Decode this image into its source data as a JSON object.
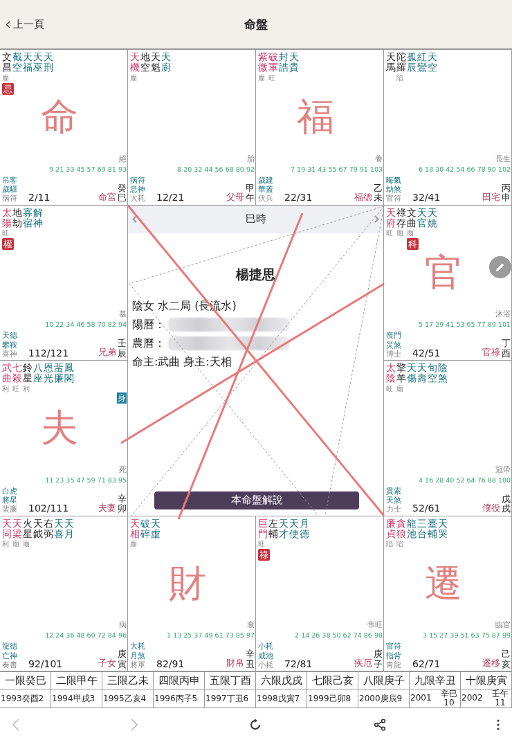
{
  "header": {
    "back": "上一頁",
    "title": "命盤"
  },
  "palaces": [
    {
      "stars": [
        {
          "name": "文昌",
          "kind": "minor",
          "brightness": "廟",
          "transform": "忌"
        },
        {
          "name": "截空",
          "kind": "aux"
        },
        {
          "name": "天福",
          "kind": "aux"
        },
        {
          "name": "天巫",
          "kind": "aux"
        },
        {
          "name": "天刑",
          "kind": "aux"
        }
      ],
      "stage": "絕",
      "ages": "9 21 33 45 57 69 81 93",
      "gods": [
        "吊客",
        "歲驛",
        "病符"
      ],
      "range": "2/11",
      "palace": "命宮",
      "ganzhi": "癸巳",
      "note": "命"
    },
    {
      "stars": [
        {
          "name": "天機",
          "kind": "major",
          "brightness": "廟"
        },
        {
          "name": "地空",
          "kind": "minor"
        },
        {
          "name": "天魁",
          "kind": "minor"
        },
        {
          "name": "天廚",
          "kind": "aux"
        }
      ],
      "stage": "胎",
      "ages": "8 20 32 44 56 68 80 92",
      "gods": [
        "病符",
        "息神",
        "大耗"
      ],
      "range": "12/21",
      "palace": "父母",
      "ganzhi": "甲午"
    },
    {
      "stars": [
        {
          "name": "紫微",
          "kind": "major",
          "brightness": "廟"
        },
        {
          "name": "破軍",
          "kind": "major",
          "brightness": "旺"
        },
        {
          "name": "封誥",
          "kind": "aux"
        },
        {
          "name": "天貴",
          "kind": "aux"
        }
      ],
      "stage": "養",
      "ages": "7 19 31 43 55 67 79 91 103",
      "gods": [
        "歲建",
        "華蓋",
        "伏兵"
      ],
      "range": "22/31",
      "palace": "福德",
      "ganzhi": "乙未",
      "note": "福"
    },
    {
      "stars": [
        {
          "name": "天馬",
          "kind": "minor"
        },
        {
          "name": "陀羅",
          "kind": "minor",
          "brightness": "陷"
        },
        {
          "name": "孤辰",
          "kind": "aux"
        },
        {
          "name": "紅鸞",
          "kind": "aux"
        },
        {
          "name": "天空",
          "kind": "aux"
        }
      ],
      "stage": "長生",
      "ages": "6 18 30 42 54 66 78 90 102",
      "gods": [
        "晦氣",
        "劫煞",
        "官符"
      ],
      "range": "32/41",
      "palace": "田宅",
      "ganzhi": "丙申"
    },
    {
      "stars": [
        {
          "name": "太陽",
          "kind": "major",
          "brightness": "旺",
          "transform": "權"
        },
        {
          "name": "地劫",
          "kind": "minor"
        },
        {
          "name": "寡宿",
          "kind": "aux"
        },
        {
          "name": "解神",
          "kind": "aux"
        }
      ],
      "stage": "墓",
      "ages": "10 22 34 46 58 70 82 94",
      "gods": [
        "天德",
        "攀鞍",
        "喜神"
      ],
      "range": "112/121",
      "palace": "兄弟",
      "ganzhi": "壬辰"
    },
    {
      "stars": [
        {
          "name": "天府",
          "kind": "major",
          "brightness": "旺"
        },
        {
          "name": "祿存",
          "kind": "minor",
          "brightness": "廟"
        },
        {
          "name": "文曲",
          "kind": "minor",
          "brightness": "廟",
          "transform": "科"
        },
        {
          "name": "天官",
          "kind": "aux"
        },
        {
          "name": "天姚",
          "kind": "aux"
        }
      ],
      "stage": "沐浴",
      "ages": "5 17 29 41 53 65 77 89 101",
      "gods": [
        "喪門",
        "災煞",
        "博士"
      ],
      "range": "42/51",
      "palace": "官祿",
      "ganzhi": "丁酉",
      "note": "官"
    },
    {
      "stars": [
        {
          "name": "武曲",
          "kind": "major",
          "brightness": "利"
        },
        {
          "name": "七殺",
          "kind": "major",
          "brightness": "旺"
        },
        {
          "name": "鈴星",
          "kind": "minor",
          "brightness": "利"
        },
        {
          "name": "八座",
          "kind": "aux"
        },
        {
          "name": "恩光",
          "kind": "aux"
        },
        {
          "name": "蜚廉",
          "kind": "aux"
        },
        {
          "name": "鳳閣",
          "kind": "aux"
        }
      ],
      "body_badge": "身",
      "stage": "死",
      "ages": "11 23 35 47 59 71 83 95",
      "gods": [
        "白虎",
        "將星",
        "蜚廉"
      ],
      "range": "102/111",
      "palace": "夫妻",
      "ganzhi": "辛卯",
      "note": "夫"
    },
    {
      "stars": [
        {
          "name": "太陰",
          "kind": "major",
          "brightness": "旺"
        },
        {
          "name": "擎羊",
          "kind": "minor",
          "brightness": "廟"
        },
        {
          "name": "天傷",
          "kind": "aux"
        },
        {
          "name": "天壽",
          "kind": "aux"
        },
        {
          "name": "旬空",
          "kind": "aux"
        },
        {
          "name": "陰煞",
          "kind": "aux"
        }
      ],
      "stage": "冠帶",
      "ages": "4 16 28 40 52 64 76 88 100",
      "gods": [
        "貫索",
        "天煞",
        "力士"
      ],
      "range": "52/61",
      "palace": "僕役",
      "ganzhi": "戊戌"
    },
    {
      "stars": [
        {
          "name": "天同",
          "kind": "major",
          "brightness": "利"
        },
        {
          "name": "天梁",
          "kind": "major",
          "brightness": "廟"
        },
        {
          "name": "火星",
          "kind": "minor",
          "brightness": "廟"
        },
        {
          "name": "天鉞",
          "kind": "minor"
        },
        {
          "name": "右弼",
          "kind": "minor"
        },
        {
          "name": "天喜",
          "kind": "aux"
        },
        {
          "name": "天月",
          "kind": "aux"
        }
      ],
      "stage": "病",
      "ages": "12 24 36 48 60 72 84 96",
      "gods": [
        "龍德",
        "亡神",
        "奏書"
      ],
      "range": "92/101",
      "palace": "子女",
      "ganzhi": "庚寅"
    },
    {
      "stars": [
        {
          "name": "天相",
          "kind": "major",
          "brightness": "廟"
        },
        {
          "name": "破碎",
          "kind": "aux"
        },
        {
          "name": "天虛",
          "kind": "aux"
        }
      ],
      "stage": "衰",
      "ages": "1 13 25 37 49 61 73 85 97",
      "gods": [
        "大耗",
        "月煞",
        "將軍"
      ],
      "range": "82/91",
      "palace": "財帛",
      "ganzhi": "辛丑",
      "note": "財"
    },
    {
      "stars": [
        {
          "name": "巨門",
          "kind": "major",
          "brightness": "旺",
          "transform": "祿"
        },
        {
          "name": "左輔",
          "kind": "minor"
        },
        {
          "name": "天才",
          "kind": "aux"
        },
        {
          "name": "天使",
          "kind": "aux"
        },
        {
          "name": "月德",
          "kind": "aux"
        }
      ],
      "stage": "帝旺",
      "ages": "2 14 26 38 50 62 74 86 98",
      "gods": [
        "小耗",
        "咸池",
        "小耗"
      ],
      "range": "72/81",
      "palace": "疾厄",
      "ganzhi": "庚子"
    },
    {
      "stars": [
        {
          "name": "廉貞",
          "kind": "major",
          "brightness": "陷"
        },
        {
          "name": "貪狼",
          "kind": "major",
          "brightness": "陷"
        },
        {
          "name": "龍池",
          "kind": "aux"
        },
        {
          "name": "三台",
          "kind": "aux"
        },
        {
          "name": "臺輔",
          "kind": "aux"
        },
        {
          "name": "天哭",
          "kind": "aux"
        }
      ],
      "stage": "臨官",
      "ages": "3 15 27 39 51 63 75 87 99",
      "gods": [
        "官符",
        "指背",
        "青龍"
      ],
      "range": "62/71",
      "palace": "遷移",
      "ganzhi": "己亥",
      "note": "遷"
    }
  ],
  "center": {
    "hour": "巳時",
    "name": "楊捷思",
    "info": [
      {
        "text": "陰女 水二局 (長流水)",
        "redacted": false
      },
      {
        "text": "陽曆：",
        "redacted": true
      },
      {
        "text": "農曆：",
        "redacted": true
      },
      {
        "text": "命主:武曲 身主:天相",
        "redacted": false
      }
    ],
    "button": "本命盤解說"
  },
  "decades": [
    {
      "label": "一限癸巳",
      "year": "1993",
      "ganzhi": "癸酉",
      "age": "2",
      "kind": "inline"
    },
    {
      "label": "二限甲午",
      "year": "1994",
      "ganzhi": "甲戌",
      "age": "3",
      "kind": "inline"
    },
    {
      "label": "三限乙未",
      "year": "1995",
      "ganzhi": "乙亥",
      "age": "4",
      "kind": "inline"
    },
    {
      "label": "四限丙申",
      "year": "1996",
      "ganzhi": "丙子",
      "age": "5",
      "kind": "inline"
    },
    {
      "label": "五限丁酉",
      "year": "1997",
      "ganzhi": "丁丑",
      "age": "6",
      "kind": "inline"
    },
    {
      "label": "六限戊戌",
      "year": "1998",
      "ganzhi": "戊寅",
      "age": "7",
      "kind": "inline"
    },
    {
      "label": "七限己亥",
      "year": "1999",
      "ganzhi": "己卯",
      "age": "8",
      "kind": "inline"
    },
    {
      "label": "八限庚子",
      "year": "2000",
      "ganzhi": "庚辰",
      "age": "9",
      "kind": "inline"
    },
    {
      "label": "九限辛丑",
      "year": "2001",
      "ganzhi": "辛巳",
      "age": "10",
      "kind": "stacked"
    },
    {
      "label": "十限庚寅",
      "year": "2002",
      "ganzhi": "壬午",
      "age": "11",
      "kind": "stacked"
    }
  ]
}
